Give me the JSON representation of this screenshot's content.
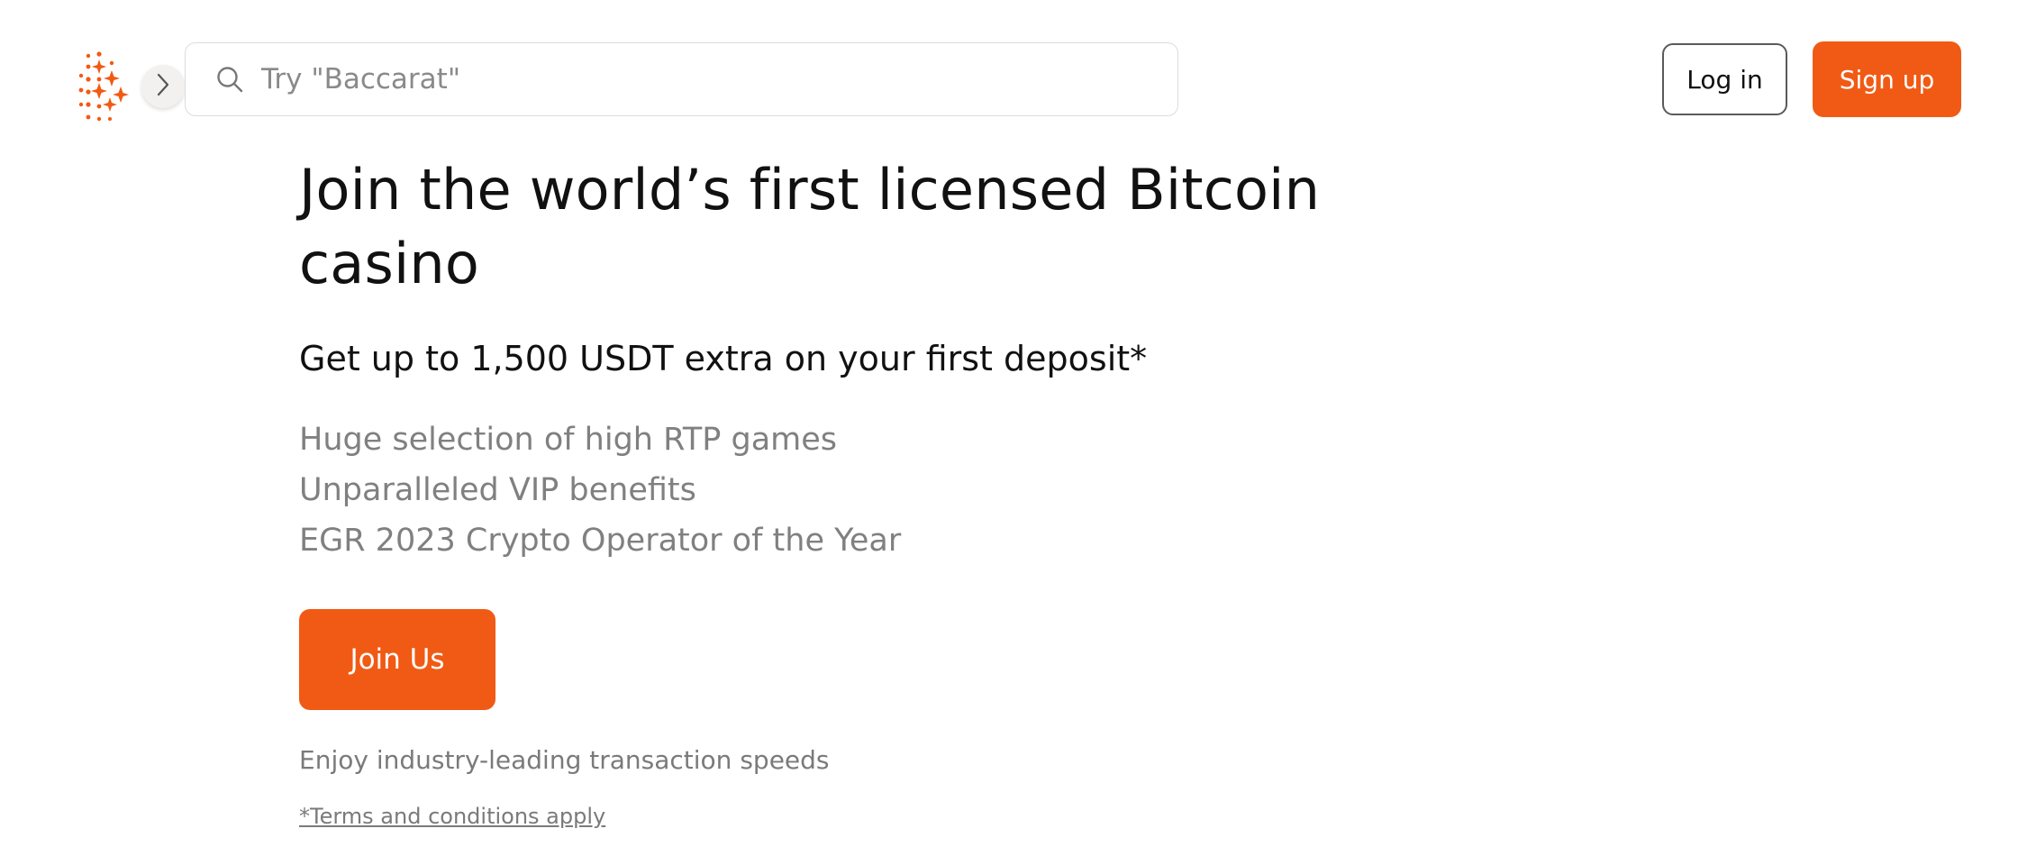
{
  "header": {
    "logo_icon": "stake-sparkle-logo",
    "toggle_icon": "chevron-right-icon",
    "search": {
      "icon": "search-icon",
      "placeholder": "Try \"Baccarat\""
    },
    "login_label": "Log in",
    "signup_label": "Sign up"
  },
  "hero": {
    "title": "Join the world’s first licensed Bitcoin casino",
    "subtitle": "Get up to 1,500 USDT extra on your first deposit*",
    "features": [
      "Huge selection of high RTP games",
      "Unparalleled VIP benefits",
      "EGR 2023 Crypto Operator of the Year"
    ],
    "cta_label": "Join Us",
    "speeds_text": "Enjoy industry-leading transaction speeds",
    "terms_text": "*Terms and conditions apply"
  },
  "colors": {
    "accent": "#f15a14",
    "text_primary": "#111111",
    "text_muted": "#808080"
  }
}
